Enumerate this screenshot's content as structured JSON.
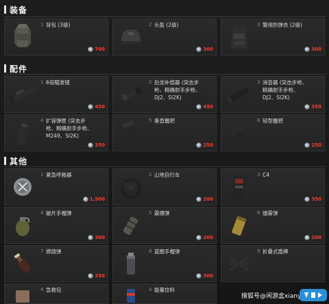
{
  "sections": [
    {
      "title": "装备",
      "items": [
        {
          "num": "1",
          "name": "背包 (3级)",
          "price": "700",
          "icon": "backpack-icon",
          "price_color": "red"
        },
        {
          "num": "2",
          "name": "头盔 (2级)",
          "price": "300",
          "icon": "helmet-icon",
          "price_color": "red"
        },
        {
          "num": "3",
          "name": "警用防弹衣 (2级)",
          "price": "300",
          "icon": "vest-icon",
          "price_color": "red"
        }
      ]
    },
    {
      "title": "配件",
      "items": [
        {
          "num": "1",
          "name": "6倍瞄准镜",
          "price": "450",
          "icon": "scope-icon",
          "price_color": "red"
        },
        {
          "num": "2",
          "name": "后坐补偿器 (突击步\n枪、精确射手步枪、\nDJ2、SI2K)",
          "price": "450",
          "icon": "compensator-icon",
          "price_color": "red"
        },
        {
          "num": "3",
          "name": "消音器 (突击步枪、\n精确射手步枪、\nDJ2、SI2K)",
          "price": "350",
          "icon": "suppressor-icon",
          "price_color": "red"
        },
        {
          "num": "4",
          "name": "扩容弹匣 (突击步\n枪、精确射手步枪、\nM249、SI2K)",
          "price": "250",
          "icon": "magazine-icon",
          "price_color": "red"
        },
        {
          "num": "5",
          "name": "垂直握把",
          "price": "250",
          "icon": "vertical-grip-icon",
          "price_color": "red"
        },
        {
          "num": "6",
          "name": "轻型握把",
          "price": "250",
          "icon": "light-grip-icon",
          "price_color": "red"
        }
      ]
    },
    {
      "title": "其他",
      "items": [
        {
          "num": "1",
          "name": "紧急呼救器",
          "price": "1,500",
          "icon": "beacon-icon",
          "price_color": "red"
        },
        {
          "num": "2",
          "name": "山地自行车",
          "price": "200",
          "icon": "bike-icon",
          "price_color": "red"
        },
        {
          "num": "3",
          "name": "C4",
          "price": "350",
          "icon": "c4-icon",
          "price_color": "red"
        },
        {
          "num": "4",
          "name": "破片手榴弹",
          "price": "300",
          "icon": "frag-grenade-icon",
          "price_color": "red"
        },
        {
          "num": "5",
          "name": "震爆弹",
          "price": "200",
          "icon": "stun-grenade-icon",
          "price_color": "red"
        },
        {
          "num": "6",
          "name": "烟雾弹",
          "price": "200",
          "icon": "smoke-grenade-icon",
          "price_color": "red"
        },
        {
          "num": "7",
          "name": "燃烧弹",
          "price": "250",
          "icon": "molotov-icon",
          "price_color": "red"
        },
        {
          "num": "8",
          "name": "蓝圈手榴弹",
          "price": "300",
          "icon": "bluezone-grenade-icon",
          "price_color": "red"
        },
        {
          "num": "9",
          "name": "折叠式盾牌",
          "price": "",
          "icon": "shield-icon",
          "price_color": "red"
        },
        {
          "num": "4",
          "name": "急救包",
          "price": "",
          "icon": "medkit-icon",
          "price_color": "red"
        },
        {
          "num": "4",
          "name": "能量饮料",
          "price": "",
          "icon": "energy-drink-icon",
          "price_color": "red"
        }
      ]
    }
  ],
  "watermark": "搜狐号@闲游盒xianyouhe"
}
